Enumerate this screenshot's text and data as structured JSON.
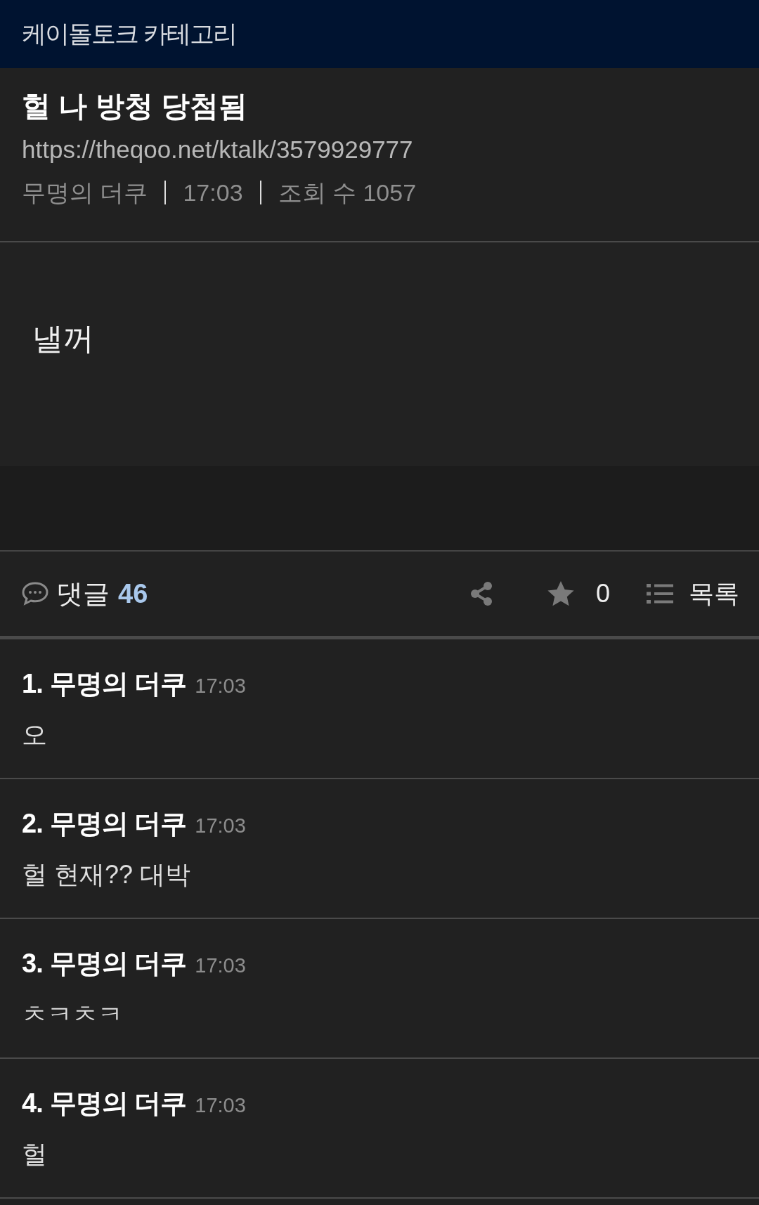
{
  "category_bar": {
    "title": "케이돌토크 카테고리"
  },
  "post": {
    "title": "헐 나 방청 당첨됨",
    "url": "https://theqoo.net/ktalk/3579929777",
    "author": "무명의 더쿠",
    "time": "17:03",
    "views": "조회 수 1057",
    "body": "낼꺼"
  },
  "actions": {
    "comments_label": "댓글",
    "comments_count": "46",
    "star_count": "0",
    "list_label": "목록"
  },
  "comments": [
    {
      "number": "1.",
      "author": "무명의 더쿠",
      "time": "17:03",
      "text": "오"
    },
    {
      "number": "2.",
      "author": "무명의 더쿠",
      "time": "17:03",
      "text": "헐 현재?? 대박"
    },
    {
      "number": "3.",
      "author": "무명의 더쿠",
      "time": "17:03",
      "text": "ㅊㅋㅊㅋ"
    },
    {
      "number": "4.",
      "author": "무명의 더쿠",
      "time": "17:03",
      "text": "헐"
    }
  ]
}
